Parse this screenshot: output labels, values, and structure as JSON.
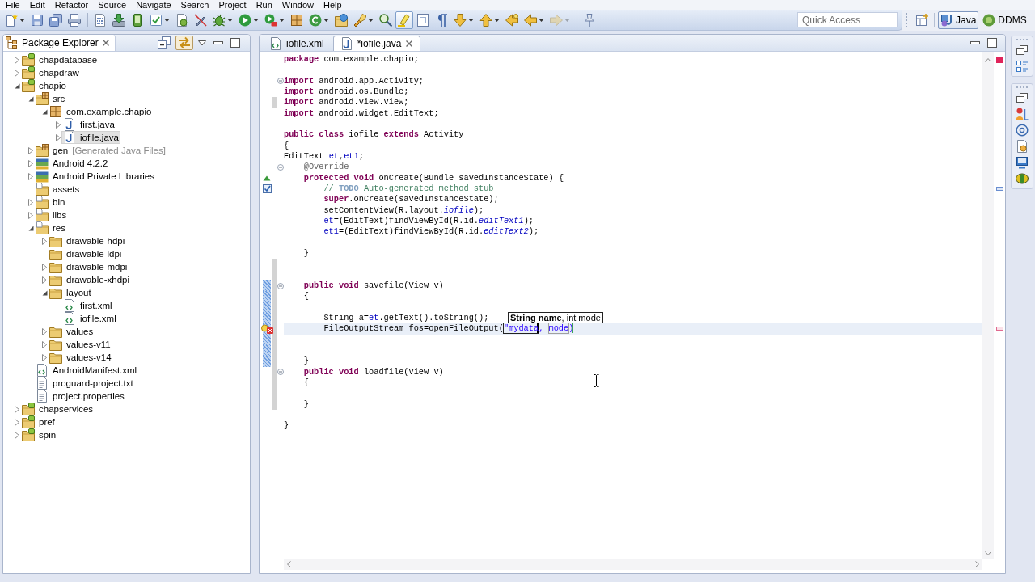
{
  "menu": [
    "File",
    "Edit",
    "Refactor",
    "Source",
    "Navigate",
    "Search",
    "Project",
    "Run",
    "Window",
    "Help"
  ],
  "toolbar": {
    "items": [
      {
        "kind": "new",
        "dropdown": true,
        "pressed": false,
        "disabled": false
      },
      {
        "kind": "save",
        "dropdown": false,
        "pressed": false,
        "disabled": false
      },
      {
        "kind": "save-all",
        "dropdown": false,
        "pressed": false,
        "disabled": false
      },
      {
        "kind": "print",
        "dropdown": false,
        "pressed": false,
        "disabled": false
      },
      {
        "kind": "separator"
      },
      {
        "kind": "binary",
        "dropdown": false,
        "pressed": false,
        "disabled": false
      },
      {
        "kind": "sdk-manager",
        "dropdown": false,
        "pressed": false,
        "disabled": false
      },
      {
        "kind": "avd-manager",
        "dropdown": false,
        "pressed": false,
        "disabled": false
      },
      {
        "kind": "lint",
        "dropdown": true,
        "pressed": false,
        "disabled": false
      },
      {
        "kind": "android-wizard",
        "dropdown": false,
        "pressed": false,
        "disabled": false
      },
      {
        "kind": "pen-cross",
        "dropdown": false,
        "pressed": false,
        "disabled": false
      },
      {
        "kind": "debug",
        "dropdown": true,
        "pressed": false,
        "disabled": false
      },
      {
        "kind": "run",
        "dropdown": true,
        "pressed": false,
        "disabled": false
      },
      {
        "kind": "external-tools",
        "dropdown": true,
        "pressed": false,
        "disabled": false
      },
      {
        "kind": "new-package",
        "dropdown": false,
        "pressed": false,
        "disabled": false
      },
      {
        "kind": "new-class",
        "dropdown": true,
        "pressed": false,
        "disabled": false
      },
      {
        "kind": "open-type",
        "dropdown": false,
        "pressed": false,
        "disabled": false
      },
      {
        "kind": "search",
        "dropdown": true,
        "pressed": false,
        "disabled": false
      },
      {
        "kind": "open-task",
        "dropdown": false,
        "pressed": false,
        "disabled": false
      },
      {
        "kind": "mark-occurrences",
        "dropdown": false,
        "pressed": true,
        "disabled": false
      },
      {
        "kind": "block-selection",
        "dropdown": false,
        "pressed": false,
        "disabled": false
      },
      {
        "kind": "show-whitespace",
        "dropdown": false,
        "pressed": false,
        "disabled": false
      },
      {
        "kind": "next-annotation",
        "dropdown": true,
        "pressed": false,
        "disabled": false
      },
      {
        "kind": "previous-annotation",
        "dropdown": true,
        "pressed": false,
        "disabled": false
      },
      {
        "kind": "last-edit",
        "dropdown": false,
        "pressed": false,
        "disabled": false
      },
      {
        "kind": "back",
        "dropdown": true,
        "pressed": false,
        "disabled": false
      },
      {
        "kind": "forward",
        "dropdown": true,
        "pressed": false,
        "disabled": true
      },
      {
        "kind": "separator"
      },
      {
        "kind": "pin-editor",
        "dropdown": false,
        "pressed": false,
        "disabled": false
      }
    ],
    "quick_access": {
      "placeholder": "Quick Access"
    },
    "perspectives": [
      {
        "label": "Java",
        "kind": "java",
        "selected": true
      },
      {
        "label": "DDMS",
        "kind": "ddms",
        "selected": false
      }
    ]
  },
  "package_explorer": {
    "title": "Package Explorer",
    "toolbar": [
      {
        "kind": "collapse-all",
        "pressed": false
      },
      {
        "kind": "link-with-editor",
        "pressed": true
      },
      {
        "kind": "view-menu",
        "pressed": false
      },
      {
        "kind": "minimize",
        "pressed": false
      },
      {
        "kind": "maximize",
        "pressed": false
      }
    ],
    "tree": [
      {
        "label": "chapdatabase",
        "kind": "project",
        "expanded": false,
        "selected": false
      },
      {
        "label": "chapdraw",
        "kind": "project",
        "expanded": false,
        "selected": false
      },
      {
        "label": "chapio",
        "kind": "project",
        "expanded": true,
        "selected": false,
        "children": [
          {
            "label": "src",
            "kind": "source-folder",
            "expanded": true,
            "selected": false,
            "children": [
              {
                "label": "com.example.chapio",
                "kind": "package",
                "expanded": true,
                "selected": false,
                "children": [
                  {
                    "label": "first.java",
                    "kind": "java-file",
                    "expanded": false,
                    "selected": false
                  },
                  {
                    "label": "iofile.java",
                    "kind": "java-file",
                    "expanded": false,
                    "selected": true
                  }
                ]
              }
            ]
          },
          {
            "label": "gen",
            "decoration": "[Generated Java Files]",
            "kind": "source-folder",
            "expanded": false,
            "selected": false
          },
          {
            "label": "Android 4.2.2",
            "kind": "library",
            "expanded": false,
            "selected": false
          },
          {
            "label": "Android Private Libraries",
            "kind": "library",
            "expanded": false,
            "selected": false
          },
          {
            "label": "assets",
            "kind": "resource-folder",
            "selected": false
          },
          {
            "label": "bin",
            "kind": "resource-folder",
            "expanded": false,
            "selected": false
          },
          {
            "label": "libs",
            "kind": "resource-folder",
            "expanded": false,
            "selected": false
          },
          {
            "label": "res",
            "kind": "resource-folder",
            "expanded": true,
            "selected": false,
            "children": [
              {
                "label": "drawable-hdpi",
                "kind": "folder",
                "expanded": false,
                "selected": false
              },
              {
                "label": "drawable-ldpi",
                "kind": "folder",
                "selected": false
              },
              {
                "label": "drawable-mdpi",
                "kind": "folder",
                "expanded": false,
                "selected": false
              },
              {
                "label": "drawable-xhdpi",
                "kind": "folder",
                "expanded": false,
                "selected": false
              },
              {
                "label": "layout",
                "kind": "folder",
                "expanded": true,
                "selected": false,
                "children": [
                  {
                    "label": "first.xml",
                    "kind": "xml-file",
                    "selected": false
                  },
                  {
                    "label": "iofile.xml",
                    "kind": "xml-file",
                    "selected": false
                  }
                ]
              },
              {
                "label": "values",
                "kind": "folder",
                "expanded": false,
                "selected": false
              },
              {
                "label": "values-v11",
                "kind": "folder",
                "expanded": false,
                "selected": false
              },
              {
                "label": "values-v14",
                "kind": "folder",
                "expanded": false,
                "selected": false
              }
            ]
          },
          {
            "label": "AndroidManifest.xml",
            "kind": "xml-file",
            "selected": false
          },
          {
            "label": "proguard-project.txt",
            "kind": "text-file",
            "selected": false
          },
          {
            "label": "project.properties",
            "kind": "text-file",
            "selected": false
          }
        ]
      },
      {
        "label": "chapservices",
        "kind": "project",
        "expanded": false,
        "selected": false
      },
      {
        "label": "pref",
        "kind": "project",
        "expanded": false,
        "selected": false
      },
      {
        "label": "spin",
        "kind": "project",
        "expanded": false,
        "selected": false
      }
    ]
  },
  "editor": {
    "tabs": [
      {
        "label": "iofile.xml",
        "kind": "xml-file",
        "selected": false
      },
      {
        "label": "*iofile.java",
        "kind": "java-file",
        "selected": true
      }
    ],
    "errors": true,
    "lines": [
      {
        "kind": "plain",
        "tokens": [
          {
            "text": "package",
            "kind": "keyword"
          },
          {
            "text": " com.example.chapio;",
            "kind": "plain"
          }
        ],
        "fold": false,
        "current": false,
        "changed": false,
        "range": false
      },
      {
        "kind": "plain",
        "fold": false,
        "current": false,
        "changed": false,
        "range": false
      },
      {
        "kind": "plain",
        "tokens": [
          {
            "text": "import",
            "kind": "keyword"
          },
          {
            "text": " android.app.Activity;",
            "kind": "plain"
          }
        ],
        "fold": true,
        "current": false,
        "changed": false,
        "range": false
      },
      {
        "kind": "plain",
        "tokens": [
          {
            "text": "import",
            "kind": "keyword"
          },
          {
            "text": " android.os.Bundle;",
            "kind": "plain"
          }
        ],
        "fold": false,
        "current": false,
        "changed": false,
        "range": false
      },
      {
        "kind": "plain",
        "tokens": [
          {
            "text": "import",
            "kind": "keyword"
          },
          {
            "text": " android.view.View;",
            "kind": "plain"
          }
        ],
        "fold": false,
        "current": false,
        "changed": true,
        "range": false
      },
      {
        "kind": "plain",
        "tokens": [
          {
            "text": "import",
            "kind": "keyword"
          },
          {
            "text": " android.widget.EditText;",
            "kind": "plain"
          }
        ],
        "fold": false,
        "current": false,
        "changed": false,
        "range": false
      },
      {
        "kind": "plain",
        "fold": false,
        "current": false,
        "changed": false,
        "range": false
      },
      {
        "kind": "plain",
        "tokens": [
          {
            "text": "public",
            "kind": "keyword"
          },
          {
            "text": " class",
            "kind": "keyword"
          },
          {
            "text": " iofile ",
            "kind": "plain"
          },
          {
            "text": "extends",
            "kind": "keyword"
          },
          {
            "text": " Activity",
            "kind": "plain"
          }
        ],
        "fold": false,
        "current": false,
        "changed": false,
        "range": false
      },
      {
        "kind": "plain",
        "tokens": [
          {
            "text": "{",
            "kind": "plain"
          }
        ],
        "fold": false,
        "current": false,
        "changed": false,
        "range": false
      },
      {
        "kind": "plain",
        "tokens": [
          {
            "text": "EditText ",
            "kind": "plain"
          },
          {
            "text": "et",
            "kind": "field"
          },
          {
            "text": ",",
            "kind": "plain"
          },
          {
            "text": "et1",
            "kind": "field"
          },
          {
            "text": ";",
            "kind": "plain"
          }
        ],
        "fold": false,
        "current": false,
        "changed": false,
        "range": false
      },
      {
        "kind": "plain",
        "tokens": [
          {
            "text": "    @Override",
            "kind": "annotation"
          }
        ],
        "fold": true,
        "current": false,
        "changed": false,
        "range": false
      },
      {
        "kind": "override",
        "tokens": [
          {
            "text": "    protected",
            "kind": "keyword"
          },
          {
            "text": " void",
            "kind": "keyword"
          },
          {
            "text": " onCreate(Bundle savedInstanceState) {",
            "kind": "plain"
          }
        ],
        "fold": false,
        "current": false,
        "changed": false,
        "range": false
      },
      {
        "kind": "task",
        "tokens": [
          {
            "text": "        // ",
            "kind": "comment"
          },
          {
            "text": "TODO",
            "kind": "task"
          },
          {
            "text": " Auto-generated method stub",
            "kind": "comment"
          }
        ],
        "fold": false,
        "current": false,
        "changed": false,
        "range": false
      },
      {
        "kind": "plain",
        "tokens": [
          {
            "text": "        super",
            "kind": "keyword"
          },
          {
            "text": ".onCreate(savedInstanceState);",
            "kind": "plain"
          }
        ],
        "fold": false,
        "current": false,
        "changed": false,
        "range": false
      },
      {
        "kind": "plain",
        "tokens": [
          {
            "text": "        setContentView(R.layout.",
            "kind": "plain"
          },
          {
            "text": "iofile",
            "kind": "static"
          },
          {
            "text": ");",
            "kind": "plain"
          }
        ],
        "fold": false,
        "current": false,
        "changed": false,
        "range": false
      },
      {
        "kind": "plain",
        "tokens": [
          {
            "text": "        et",
            "kind": "field"
          },
          {
            "text": "=(EditText)findViewById(R.id.",
            "kind": "plain"
          },
          {
            "text": "editText1",
            "kind": "static"
          },
          {
            "text": ");",
            "kind": "plain"
          }
        ],
        "fold": false,
        "current": false,
        "changed": false,
        "range": false
      },
      {
        "kind": "plain",
        "tokens": [
          {
            "text": "        et1",
            "kind": "field"
          },
          {
            "text": "=(EditText)findViewById(R.id.",
            "kind": "plain"
          },
          {
            "text": "editText2",
            "kind": "static"
          },
          {
            "text": ");",
            "kind": "plain"
          }
        ],
        "fold": false,
        "current": false,
        "changed": false,
        "range": false
      },
      {
        "kind": "plain",
        "fold": false,
        "current": false,
        "changed": false,
        "range": false
      },
      {
        "kind": "plain",
        "tokens": [
          {
            "text": "    }",
            "kind": "plain"
          }
        ],
        "fold": false,
        "current": false,
        "changed": false,
        "range": false
      },
      {
        "kind": "plain",
        "fold": false,
        "current": false,
        "changed": true,
        "range": false
      },
      {
        "kind": "plain",
        "fold": false,
        "current": false,
        "changed": true,
        "range": false
      },
      {
        "kind": "plain",
        "tokens": [
          {
            "text": "    public",
            "kind": "keyword"
          },
          {
            "text": " void",
            "kind": "keyword"
          },
          {
            "text": " savefile(View v)",
            "kind": "plain"
          }
        ],
        "fold": true,
        "current": false,
        "changed": true,
        "range": true
      },
      {
        "kind": "plain",
        "tokens": [
          {
            "text": "    {",
            "kind": "plain"
          }
        ],
        "fold": false,
        "current": false,
        "changed": true,
        "range": true
      },
      {
        "kind": "plain",
        "fold": false,
        "current": false,
        "changed": true,
        "range": true
      },
      {
        "kind": "plain",
        "tokens": [
          {
            "text": "        String a=",
            "kind": "plain"
          },
          {
            "text": "et",
            "kind": "field"
          },
          {
            "text": ".getText().toString();",
            "kind": "plain"
          }
        ],
        "fold": false,
        "current": false,
        "changed": true,
        "range": true
      },
      {
        "kind": "error",
        "tokens": [
          {
            "text": "        FileOutputStream fos=openFileOutput(",
            "kind": "plain"
          },
          {
            "text": "\"mydata",
            "kind": "linked",
            "caret": true
          },
          {
            "text": ", ",
            "kind": "string"
          },
          {
            "text": "mode",
            "kind": "linked"
          },
          {
            "text": ")",
            "kind": "string",
            "exit": true
          }
        ],
        "fold": false,
        "current": true,
        "changed": true,
        "range": true
      },
      {
        "kind": "plain",
        "fold": false,
        "current": false,
        "changed": true,
        "range": true
      },
      {
        "kind": "plain",
        "fold": false,
        "current": false,
        "changed": true,
        "range": true
      },
      {
        "kind": "plain",
        "tokens": [
          {
            "text": "    }",
            "kind": "plain"
          }
        ],
        "fold": false,
        "current": false,
        "changed": true,
        "range": true
      },
      {
        "kind": "plain",
        "tokens": [
          {
            "text": "    public",
            "kind": "keyword"
          },
          {
            "text": " void",
            "kind": "keyword"
          },
          {
            "text": " loadfile(View v)",
            "kind": "plain"
          }
        ],
        "fold": true,
        "current": false,
        "changed": true,
        "range": false
      },
      {
        "kind": "plain",
        "tokens": [
          {
            "text": "    {",
            "kind": "plain"
          }
        ],
        "fold": false,
        "current": false,
        "changed": true,
        "range": false
      },
      {
        "kind": "plain",
        "fold": false,
        "current": false,
        "changed": true,
        "range": false
      },
      {
        "kind": "plain",
        "tokens": [
          {
            "text": "    }",
            "kind": "plain"
          }
        ],
        "fold": false,
        "current": false,
        "changed": true,
        "range": false
      },
      {
        "kind": "plain",
        "fold": false,
        "current": false,
        "changed": false,
        "range": false
      },
      {
        "kind": "plain",
        "tokens": [
          {
            "text": "}",
            "kind": "plain"
          }
        ],
        "fold": false,
        "current": false,
        "changed": false,
        "range": false
      }
    ],
    "parameter_hint": "**String name**, int mode"
  }
}
